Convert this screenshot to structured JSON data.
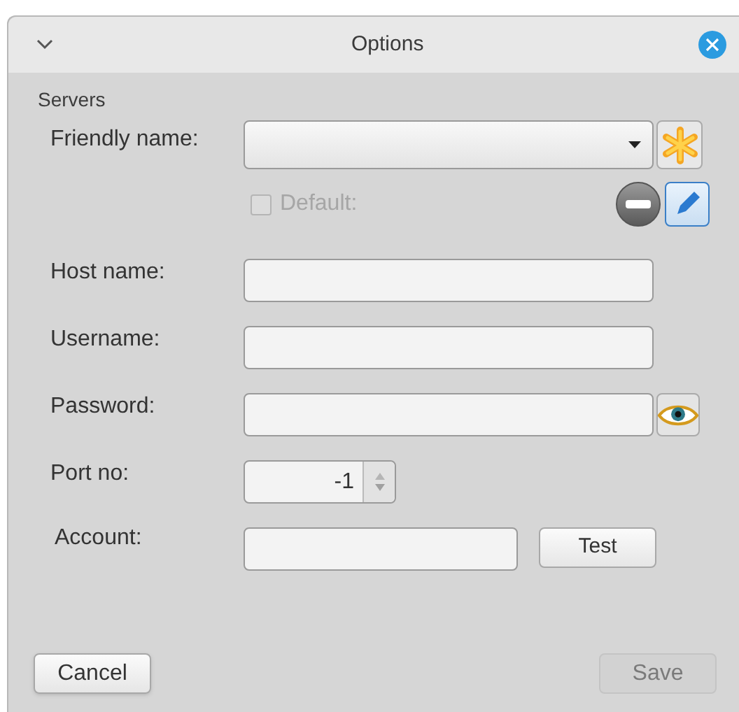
{
  "window": {
    "title": "Options"
  },
  "section": {
    "label": "Servers"
  },
  "friendly_name": {
    "label": "Friendly name:"
  },
  "default": {
    "label": "Default:",
    "checked": false,
    "disabled": true
  },
  "fields": [
    {
      "kind": "text",
      "label": "Host name:"
    },
    {
      "kind": "text",
      "label": "Username:"
    },
    {
      "kind": "password",
      "label": "Password:"
    },
    {
      "kind": "spin",
      "label": "Port no:",
      "value": "-1"
    },
    {
      "kind": "account",
      "label": "Account:",
      "button": "Test"
    }
  ],
  "buttons": [
    {
      "label": "Cancel",
      "disabled": false
    },
    {
      "label": "Save",
      "disabled": true
    }
  ]
}
